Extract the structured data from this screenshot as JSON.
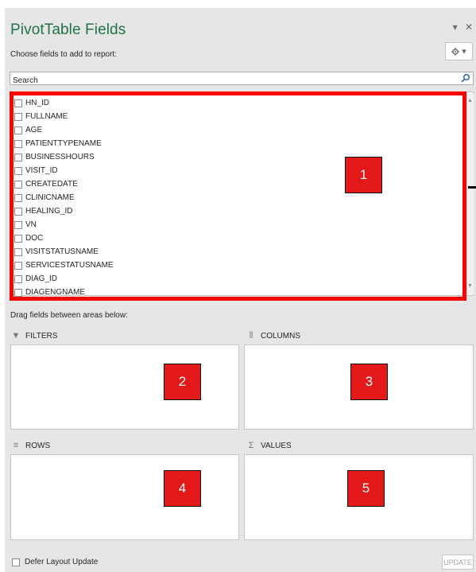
{
  "panel": {
    "title": "PivotTable Fields",
    "subtitle": "Choose fields to add to report:",
    "dropdown_icon": "▾",
    "close_icon": "✕"
  },
  "search": {
    "placeholder": "Search",
    "value": "Search"
  },
  "fields": [
    {
      "label": "HN_ID",
      "checked": false
    },
    {
      "label": "FULLNAME",
      "checked": false
    },
    {
      "label": "AGE",
      "checked": false
    },
    {
      "label": "PATIENTTYPENAME",
      "checked": false
    },
    {
      "label": "BUSINESSHOURS",
      "checked": false
    },
    {
      "label": "VISIT_ID",
      "checked": false
    },
    {
      "label": "CREATEDATE",
      "checked": false
    },
    {
      "label": "CLINICNAME",
      "checked": false
    },
    {
      "label": "HEALING_ID",
      "checked": false
    },
    {
      "label": "VN",
      "checked": false
    },
    {
      "label": "DOC",
      "checked": false
    },
    {
      "label": "VISITSTATUSNAME",
      "checked": false
    },
    {
      "label": "SERVICESTATUSNAME",
      "checked": false
    },
    {
      "label": "DIAG_ID",
      "checked": false
    },
    {
      "label": "DIAGENGNAME",
      "checked": false
    }
  ],
  "areas": {
    "drag_label": "Drag fields between areas below:",
    "filters": {
      "label": "FILTERS",
      "icon": "▼"
    },
    "columns": {
      "label": "COLUMNS",
      "icon": "⦀"
    },
    "rows": {
      "label": "ROWS",
      "icon": "≡"
    },
    "values": {
      "label": "VALUES",
      "icon": "Σ"
    }
  },
  "annotations": [
    "1",
    "2",
    "3",
    "4",
    "5"
  ],
  "footer": {
    "defer_label": "Defer Layout Update",
    "defer_checked": false,
    "update_label": "UPDATE"
  },
  "colors": {
    "title": "#217346",
    "annotation_red": "#e31818",
    "frame_red": "#ff0000",
    "pane_bg": "#e6e6e6"
  }
}
